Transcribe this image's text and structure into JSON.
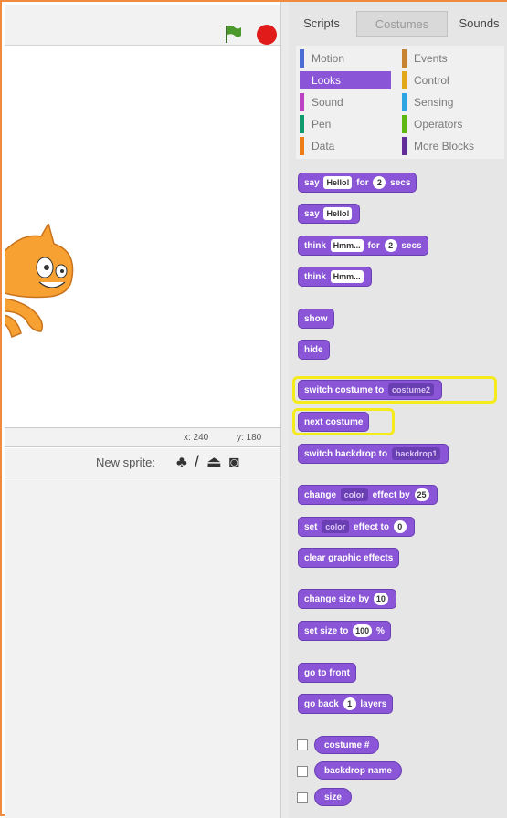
{
  "stage": {
    "x_label": "x: 240",
    "y_label": "y: 180"
  },
  "new_sprite": {
    "label": "New sprite:",
    "icons": [
      "paint-new-sprite-icon",
      "choose-sprite-icon",
      "upload-sprite-icon",
      "camera-icon"
    ]
  },
  "tabs": {
    "scripts": "Scripts",
    "costumes": "Costumes",
    "sounds": "Sounds"
  },
  "categories": {
    "motion": "Motion",
    "looks": "Looks",
    "sound": "Sound",
    "pen": "Pen",
    "data": "Data",
    "events": "Events",
    "control": "Control",
    "sensing": "Sensing",
    "operators": "Operators",
    "more": "More Blocks"
  },
  "colors": {
    "accent": "#8a55d7",
    "highlight": "#f4ea1c",
    "stop": "#e11a1a",
    "frame": "#f08a3e"
  },
  "blocks": {
    "say_for": {
      "a": "say",
      "b": "Hello!",
      "c": "for",
      "d": "2",
      "e": "secs"
    },
    "say": {
      "a": "say",
      "b": "Hello!"
    },
    "think_for": {
      "a": "think",
      "b": "Hmm...",
      "c": "for",
      "d": "2",
      "e": "secs"
    },
    "think": {
      "a": "think",
      "b": "Hmm..."
    },
    "show": "show",
    "hide": "hide",
    "switch_costume": {
      "a": "switch costume to",
      "b": "costume2"
    },
    "next_costume": "next costume",
    "switch_backdrop": {
      "a": "switch backdrop to",
      "b": "backdrop1"
    },
    "change_effect": {
      "a": "change",
      "b": "color",
      "c": "effect by",
      "d": "25"
    },
    "set_effect": {
      "a": "set",
      "b": "color",
      "c": "effect to",
      "d": "0"
    },
    "clear_effects": "clear graphic effects",
    "change_size": {
      "a": "change size by",
      "b": "10"
    },
    "set_size": {
      "a": "set size to",
      "b": "100",
      "c": "%"
    },
    "go_front": "go to front",
    "go_back": {
      "a": "go back",
      "b": "1",
      "c": "layers"
    },
    "costume_num": "costume #",
    "backdrop_name": "backdrop name",
    "size": "size"
  }
}
